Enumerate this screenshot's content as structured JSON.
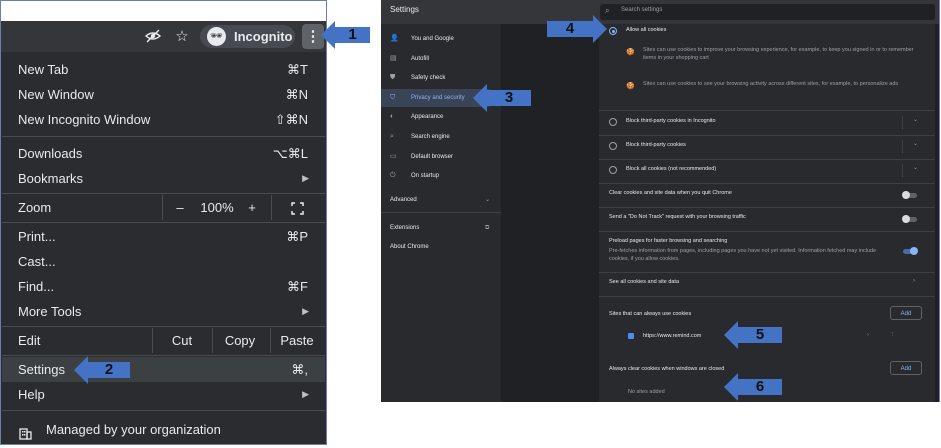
{
  "chrome_menu": {
    "incognito_label": "Incognito",
    "items": {
      "new_tab": {
        "label": "New Tab",
        "shortcut": "⌘T"
      },
      "new_window": {
        "label": "New Window",
        "shortcut": "⌘N"
      },
      "new_incognito": {
        "label": "New Incognito Window",
        "shortcut": "⇧⌘N"
      },
      "downloads": {
        "label": "Downloads",
        "shortcut": "⌥⌘L"
      },
      "bookmarks": {
        "label": "Bookmarks"
      },
      "print": {
        "label": "Print...",
        "shortcut": "⌘P"
      },
      "cast": {
        "label": "Cast..."
      },
      "find": {
        "label": "Find...",
        "shortcut": "⌘F"
      },
      "more_tools": {
        "label": "More Tools"
      },
      "settings": {
        "label": "Settings",
        "shortcut": "⌘,"
      },
      "help": {
        "label": "Help"
      },
      "managed": {
        "label": "Managed by your organization"
      }
    },
    "zoom": {
      "label": "Zoom",
      "minus": "–",
      "value": "100%",
      "plus": "+"
    },
    "edit": {
      "label": "Edit",
      "cut": "Cut",
      "copy": "Copy",
      "paste": "Paste"
    }
  },
  "settings": {
    "title": "Settings",
    "search_placeholder": "Search settings",
    "sidebar": {
      "you_and_google": "You and Google",
      "autofill": "Autofill",
      "safety_check": "Safety check",
      "privacy": "Privacy and security",
      "appearance": "Appearance",
      "search_engine": "Search engine",
      "default_browser": "Default browser",
      "on_startup": "On startup",
      "advanced": "Advanced",
      "extensions": "Extensions",
      "about": "About Chrome"
    },
    "cookies": {
      "allow_all": "Allow all cookies",
      "allow_all_desc1": "Sites can use cookies to improve your browsing experience, for example, to keep you signed in or to remember items in your shopping cart",
      "allow_all_desc2": "Sites can use cookies to see your browsing activity across different sites, for example, to personalize ads",
      "block_third_incognito": "Block third-party cookies in Incognito",
      "block_third": "Block third-party cookies",
      "block_all": "Block all cookies (not recommended)",
      "clear_on_quit": "Clear cookies and site data when you quit Chrome",
      "do_not_track": "Send a \"Do Not Track\" request with your browsing traffic",
      "preload_title": "Preload pages for faster browsing and searching",
      "preload_desc": "Pre-fetches information from pages, including pages you have not yet visited. Information fetched may include cookies, if you allow cookies.",
      "see_all": "See all cookies and site data",
      "always_use": "Sites that can always use cookies",
      "add": "Add",
      "site_url": "https://www.remind.com",
      "always_clear": "Always clear cookies when windows are closed",
      "no_sites": "No sites added"
    }
  },
  "steps": [
    "1",
    "2",
    "3",
    "4",
    "5",
    "6"
  ]
}
